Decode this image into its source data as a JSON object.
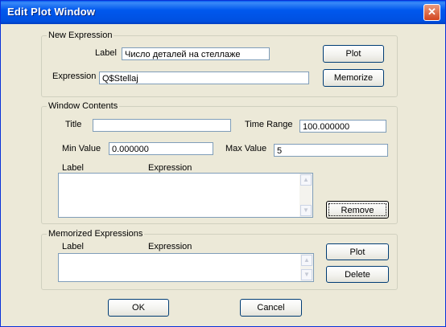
{
  "window": {
    "title": "Edit Plot Window",
    "close_glyph": "✕"
  },
  "new_expression": {
    "legend": "New Expression",
    "label_caption": "Label",
    "label_value": "Число деталей на стеллаже",
    "expression_caption": "Expression",
    "expression_value": "Q$Stellaj",
    "plot_button": "Plot",
    "memorize_button": "Memorize"
  },
  "window_contents": {
    "legend": "Window Contents",
    "title_caption": "Title",
    "title_value": "",
    "time_range_caption": "Time Range",
    "time_range_value": "100.000000",
    "min_value_caption": "Min Value",
    "min_value_value": "0.000000",
    "max_value_caption": "Max Value",
    "max_value_value": "5",
    "list_header_label": "Label",
    "list_header_expression": "Expression",
    "remove_button": "Remove"
  },
  "memorized_expressions": {
    "legend": "Memorized Expressions",
    "list_header_label": "Label",
    "list_header_expression": "Expression",
    "plot_button": "Plot",
    "delete_button": "Delete"
  },
  "footer": {
    "ok_button": "OK",
    "cancel_button": "Cancel"
  },
  "icons": {
    "scroll_up": "scroll-up-arrow-icon",
    "scroll_down": "scroll-down-arrow-icon"
  }
}
